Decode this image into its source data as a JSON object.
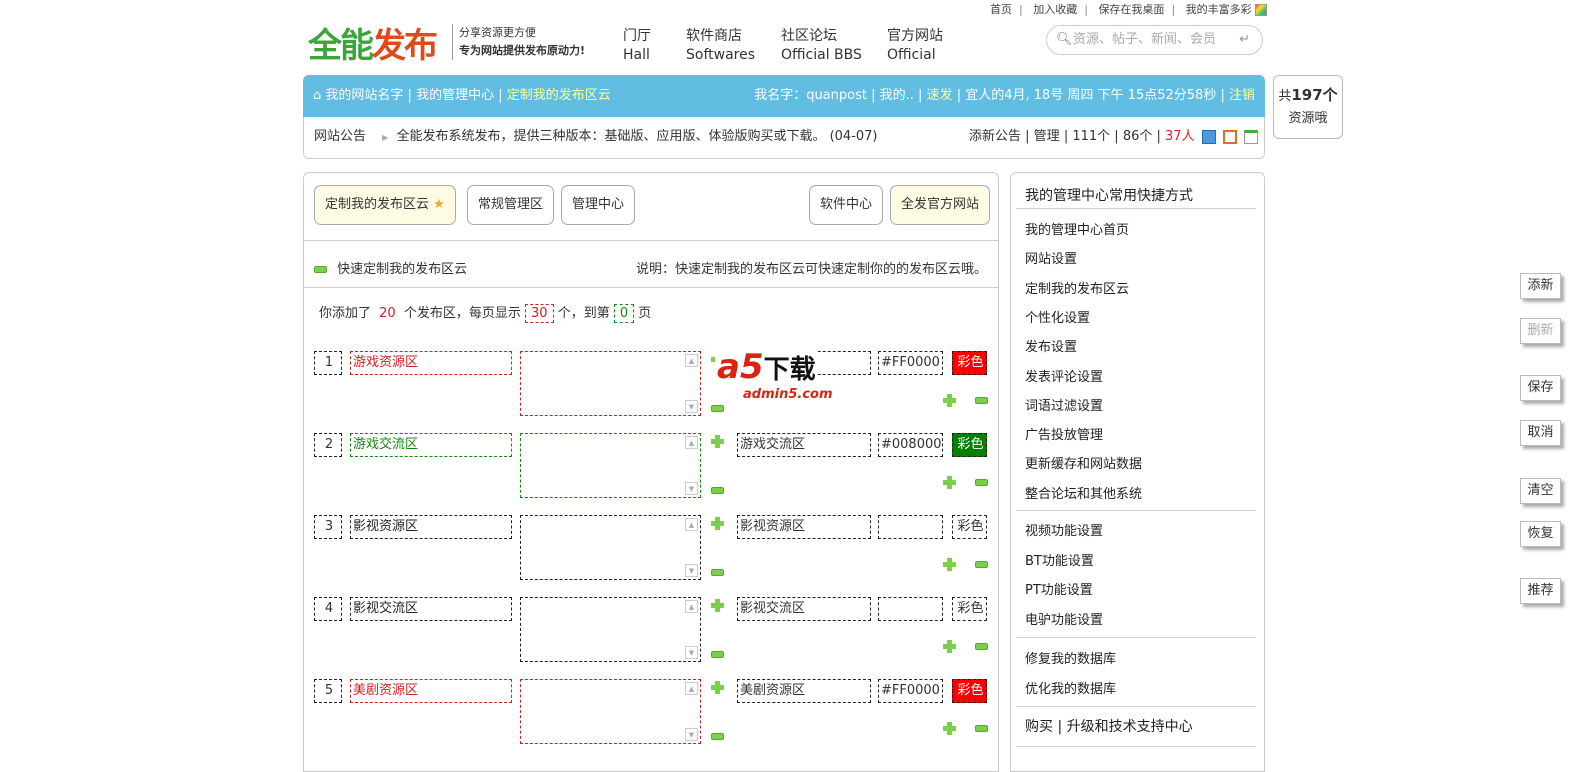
{
  "top_links": [
    "首页",
    "加入收藏",
    "保存在我桌面",
    "我的丰富多彩"
  ],
  "logo": {
    "text_green": "全能",
    "text_red": "发布",
    "slogan1": "分享资源更方便",
    "slogan2": "专为网站提供发布原动力!"
  },
  "nav": [
    {
      "cn": "门厅",
      "en": "Hall"
    },
    {
      "cn": "软件商店",
      "en": "Softwares"
    },
    {
      "cn": "社区论坛",
      "en": "Official BBS"
    },
    {
      "cn": "官方网站",
      "en": "Official"
    }
  ],
  "search": {
    "placeholder": "资源、帖子、新闻、会员"
  },
  "bar": {
    "crumb1": "我的网站名字",
    "crumb2": "我的管理中心",
    "crumb3": "定制我的发布区云",
    "user": "我名字：quanpost",
    "mine": "我的..",
    "quick": "速发",
    "datetime": "宜人的4月, 18号 周四 下午 15点52分58秒",
    "logout": "注销"
  },
  "notice": {
    "label": "网站公告",
    "text": "全能发布系统发布，提供三种版本：基础版、应用版、体验版购买或下载。 (04-07)",
    "add": "添新公告",
    "manage": "管理",
    "c1": "111个",
    "c2": "86个",
    "c3": "37人"
  },
  "counter": {
    "prefix": "共",
    "count": "197个",
    "suffix": "资源哦"
  },
  "toolbar": {
    "b1": "定制我的发布区云",
    "b2": "常规管理区",
    "b3": "管理中心",
    "b4": "软件中心",
    "b5": "全发官方网站"
  },
  "section": {
    "title": "快速定制我的发布区云",
    "desc": "说明：快速定制我的发布区云可快速定制你的的发布区云哦。"
  },
  "summary": {
    "t1": "你添加了",
    "count": "20",
    "t2": "个发布区，每页显示",
    "per_page": "30",
    "t3": "个，到第",
    "page": "0",
    "t4": "页"
  },
  "rows": [
    {
      "num": "1",
      "name": "游戏资源区",
      "alias": "",
      "color": "#FF0000",
      "btn": "彩色",
      "fill": "#ff0000",
      "text_color": "#cc2222"
    },
    {
      "num": "2",
      "name": "游戏交流区",
      "alias": "游戏交流区",
      "color": "#008000",
      "btn": "彩色",
      "fill": "#008000",
      "text_color": "#118811"
    },
    {
      "num": "3",
      "name": "影视资源区",
      "alias": "影视资源区",
      "color": "",
      "btn": "彩色",
      "fill": "",
      "text_color": "#222222"
    },
    {
      "num": "4",
      "name": "影视交流区",
      "alias": "影视交流区",
      "color": "",
      "btn": "彩色",
      "fill": "",
      "text_color": "#222222"
    },
    {
      "num": "5",
      "name": "美剧资源区",
      "alias": "美剧资源区",
      "color": "#FF0000",
      "btn": "彩色",
      "fill": "#ff0000",
      "text_color": "#cc2222"
    }
  ],
  "watermark": {
    "brand": "a5下载",
    "site": "admin5.com"
  },
  "sidebar": {
    "title": "我的管理中心常用快捷方式",
    "group1": [
      "我的管理中心首页",
      "网站设置",
      "定制我的发布区云",
      "个性化设置",
      "发布设置",
      "发表评论设置",
      "词语过滤设置",
      "广告投放管理",
      "更新缓存和网站数据",
      "整合论坛和其他系统"
    ],
    "group2": [
      "视频功能设置",
      "BT功能设置",
      "PT功能设置",
      "电驴功能设置"
    ],
    "group3": [
      "修复我的数据库",
      "优化我的数据库"
    ],
    "footer": "购买 | 升级和技术支持中心"
  },
  "float_buttons": [
    {
      "label": "添新",
      "disabled": false
    },
    {
      "label": "删新",
      "disabled": true
    },
    {
      "label": "保存",
      "disabled": false
    },
    {
      "label": "取消",
      "disabled": false
    },
    {
      "label": "清空",
      "disabled": false
    },
    {
      "label": "恢复",
      "disabled": false
    },
    {
      "label": "推荐",
      "disabled": false
    }
  ]
}
